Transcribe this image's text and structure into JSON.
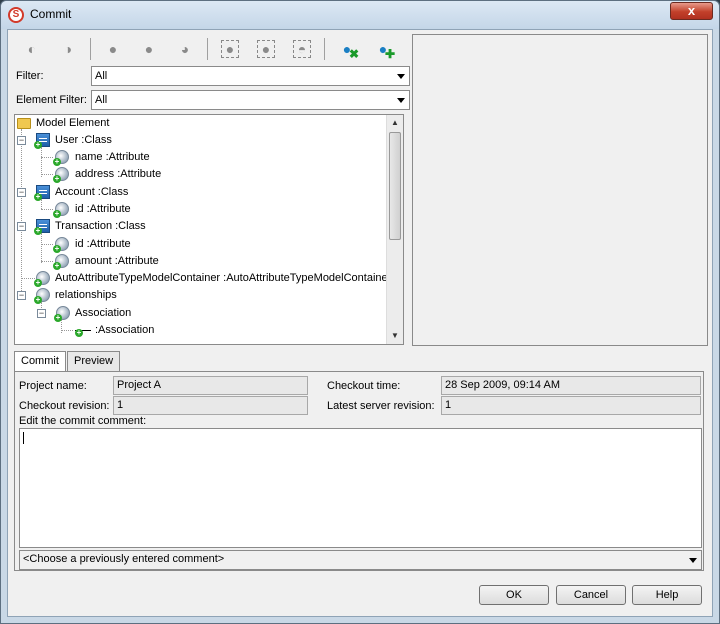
{
  "window": {
    "title": "Commit",
    "close_label": "x"
  },
  "toolbar": {
    "buttons": [
      {
        "icon": "commit-all-icon"
      },
      {
        "icon": "revert-all-icon"
      },
      {
        "icon": "select-icon"
      },
      {
        "icon": "deselect-icon"
      },
      {
        "icon": "refresh-icon"
      },
      {
        "icon": "expand-selected-icon"
      },
      {
        "icon": "collapse-selected-icon"
      },
      {
        "icon": "filter-selected-icon"
      },
      {
        "icon": "commit-checked-icon"
      },
      {
        "icon": "revert-checked-icon"
      }
    ]
  },
  "filter": {
    "label": "Filter:",
    "value": "All"
  },
  "element_filter": {
    "label": "Element Filter:",
    "value": "All"
  },
  "tree": {
    "root": "Model Element",
    "nodes": [
      {
        "label": "User :Class"
      },
      {
        "label": "name :Attribute"
      },
      {
        "label": "address :Attribute"
      },
      {
        "label": "Account :Class"
      },
      {
        "label": "id :Attribute"
      },
      {
        "label": "Transaction :Class"
      },
      {
        "label": "id :Attribute"
      },
      {
        "label": "amount :Attribute"
      },
      {
        "label": "AutoAttributeTypeModelContainer :AutoAttributeTypeModelContainer"
      },
      {
        "label": "relationships"
      },
      {
        "label": "Association"
      },
      {
        "label": ":Association"
      }
    ]
  },
  "tabs": {
    "commit": "Commit",
    "preview": "Preview"
  },
  "info": {
    "project_name_label": "Project name:",
    "project_name": "Project A",
    "checkout_time_label": "Checkout time:",
    "checkout_time": "28 Sep 2009, 09:14 AM",
    "checkout_revision_label": "Checkout revision:",
    "checkout_revision": "1",
    "latest_revision_label": "Latest server revision:",
    "latest_revision": "1"
  },
  "comment": {
    "label": "Edit the commit comment:",
    "value": "",
    "history_placeholder": "<Choose a previously entered comment>"
  },
  "buttons": {
    "ok": "OK",
    "cancel": "Cancel",
    "help": "Help"
  }
}
